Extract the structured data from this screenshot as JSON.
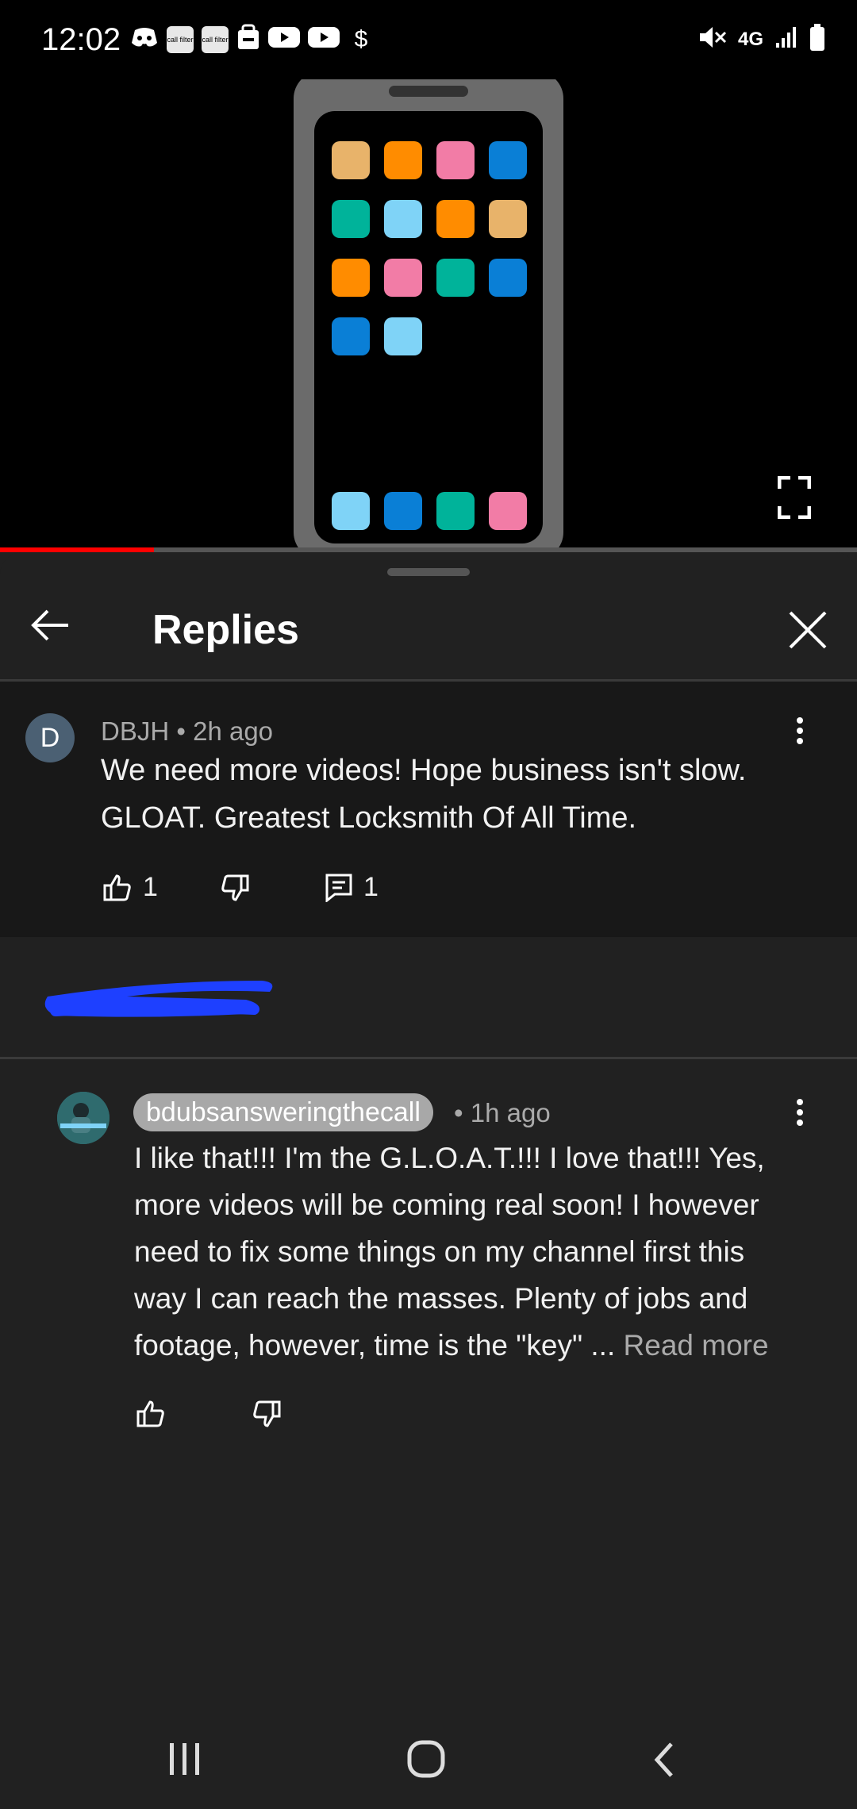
{
  "status_bar": {
    "time": "12:02",
    "left_icons": [
      "discord-icon",
      "call-filter-icon",
      "call-filter-icon",
      "bag-icon",
      "youtube-icon",
      "youtube-icon",
      "dollar-icon"
    ],
    "call_filter_label": "call filter",
    "dollar": "$",
    "network": "4G",
    "right_icons": [
      "mute-icon",
      "network-4g-icon",
      "signal-icon",
      "battery-icon"
    ]
  },
  "video": {
    "progress_fraction": 0.18,
    "progress_color": "#ff0000",
    "fullscreen_icon": "fullscreen-icon"
  },
  "sheet": {
    "title": "Replies",
    "back_icon": "arrow-left-icon",
    "close_icon": "close-icon"
  },
  "comment": {
    "avatar_letter": "D",
    "author": "DBJH",
    "separator": "•",
    "time": "2h ago",
    "line1": "We need more videos!  Hope business isn't slow.",
    "line2": "GLOAT.  Greatest Locksmith Of All Time.",
    "likes": "1",
    "replies": "1"
  },
  "reply": {
    "author": "bdubsansweringthecall",
    "separator": "•",
    "time": "1h ago",
    "lines": [
      "I like that!!! I'm the G.L.O.A.T.!!! I love that!!! Yes,",
      "more videos will be coming real soon! I however",
      "need to fix some things on my channel first this",
      "way I can reach the masses. Plenty of jobs and",
      "footage, however, time is the \"key\" ..."
    ],
    "read_more": "Read more"
  },
  "nav": {
    "recents_icon": "recents-icon",
    "home_icon": "home-icon",
    "back_icon": "back-chevron-icon"
  },
  "colors": {
    "background": "#212121",
    "comment_bg": "#181818",
    "accent_red": "#ff0000",
    "redaction_blue": "#1e40ff"
  }
}
